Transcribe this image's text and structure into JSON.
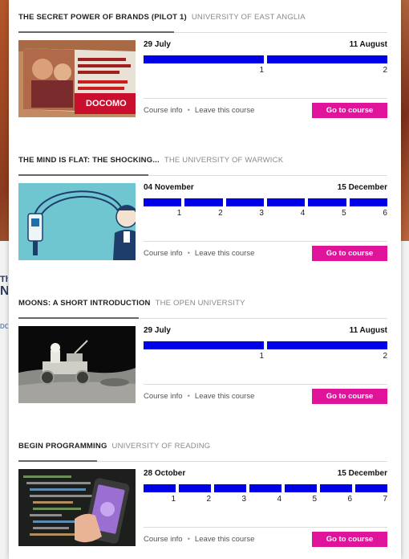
{
  "background": {
    "side_text_1": "Th",
    "side_text_2": "N",
    "side_text_3": "DC"
  },
  "courses": [
    {
      "title": "The secret power of brands (Pilot 1)",
      "university": "University of East Anglia",
      "start": "29 July",
      "end": "11 August",
      "weeks": [
        "1",
        "2"
      ],
      "course_info": "Course info",
      "leave": "Leave this course",
      "go": "Go to course",
      "thumb_text": "DOCOMO"
    },
    {
      "title": "The Mind is Flat: the Shocking...",
      "university": "The University of Warwick",
      "start": "04 November",
      "end": "15 December",
      "weeks": [
        "1",
        "2",
        "3",
        "4",
        "5",
        "6"
      ],
      "course_info": "Course info",
      "leave": "Leave this course",
      "go": "Go to course"
    },
    {
      "title": "Moons: A Short Introduction",
      "university": "The Open University",
      "start": "29 July",
      "end": "11 August",
      "weeks": [
        "1",
        "2"
      ],
      "course_info": "Course info",
      "leave": "Leave this course",
      "go": "Go to course"
    },
    {
      "title": "Begin Programming",
      "university": "University of Reading",
      "start": "28 October",
      "end": "15 December",
      "weeks": [
        "1",
        "2",
        "3",
        "4",
        "5",
        "6",
        "7"
      ],
      "course_info": "Course info",
      "leave": "Leave this course",
      "go": "Go to course"
    }
  ],
  "colors": {
    "timeline": "#0000e6",
    "button": "#e0149b"
  }
}
